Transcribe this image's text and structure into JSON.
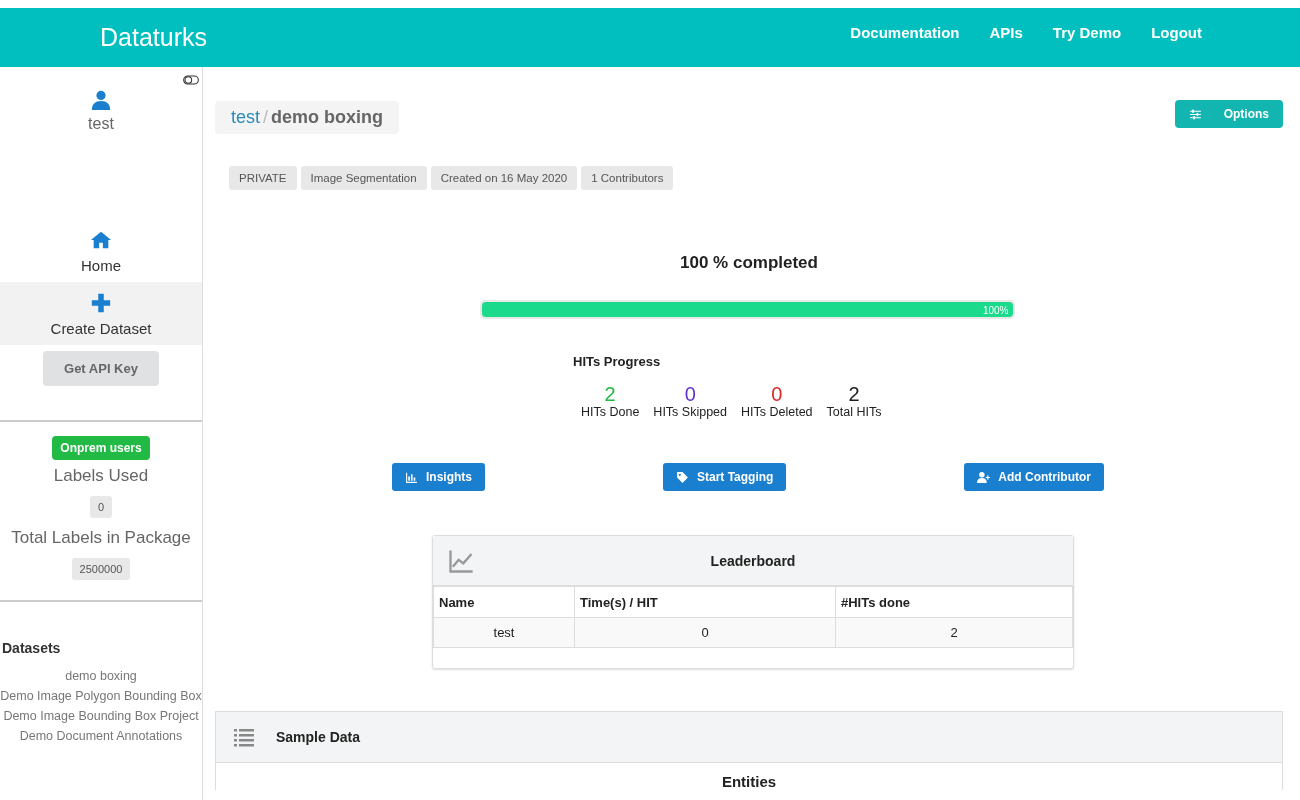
{
  "header": {
    "brand": "Dataturks",
    "nav": [
      "Documentation",
      "APIs",
      "Try Demo",
      "Logout"
    ]
  },
  "sidebar": {
    "user": "test",
    "items": [
      {
        "label": "Home",
        "kind": "home",
        "selected": false
      },
      {
        "label": "Create Dataset",
        "kind": "plus",
        "selected": true
      }
    ],
    "api_button": "Get API Key",
    "plan_badge": "Onprem users",
    "labels_used_title": "Labels Used",
    "labels_used": "0",
    "total_labels_title": "Total Labels in Package",
    "total_labels": "2500000",
    "datasets_title": "Datasets",
    "datasets": [
      "demo boxing",
      "Demo Image Polygon Bounding Box",
      "Demo Image Bounding Box Project",
      "Demo Document Annotations"
    ]
  },
  "breadcrumb": {
    "owner": "test",
    "separator": "/",
    "project": "demo boxing"
  },
  "options_button": "Options",
  "tags": [
    "PRIVATE",
    "Image Segmentation",
    "Created on 16 May 2020",
    "1 Contributors"
  ],
  "progress": {
    "title": "100 % completed",
    "level": 1,
    "reading": "100%"
  },
  "hits": {
    "title": "HITs Progress",
    "stats": [
      {
        "value": "2",
        "label": "HITs Done",
        "color": "#21ba45"
      },
      {
        "value": "0",
        "label": "HITs Skipped",
        "color": "#6435c9"
      },
      {
        "value": "0",
        "label": "HITs Deleted",
        "color": "#db2828"
      },
      {
        "value": "2",
        "label": "Total HITs",
        "color": "#1b1c1d"
      }
    ]
  },
  "actions": [
    {
      "label": "Insights",
      "kind": "chart"
    },
    {
      "label": "Start Tagging",
      "kind": "tag"
    },
    {
      "label": "Add Contributor",
      "kind": "user-plus"
    }
  ],
  "leaderboard": {
    "title": "Leaderboard",
    "columns": [
      "Name",
      "Time(s) / HIT",
      "#HITs done"
    ],
    "rows": [
      [
        "test",
        "0",
        "2"
      ]
    ]
  },
  "sample": {
    "title": "Sample Data",
    "subtitle": "Entities"
  }
}
